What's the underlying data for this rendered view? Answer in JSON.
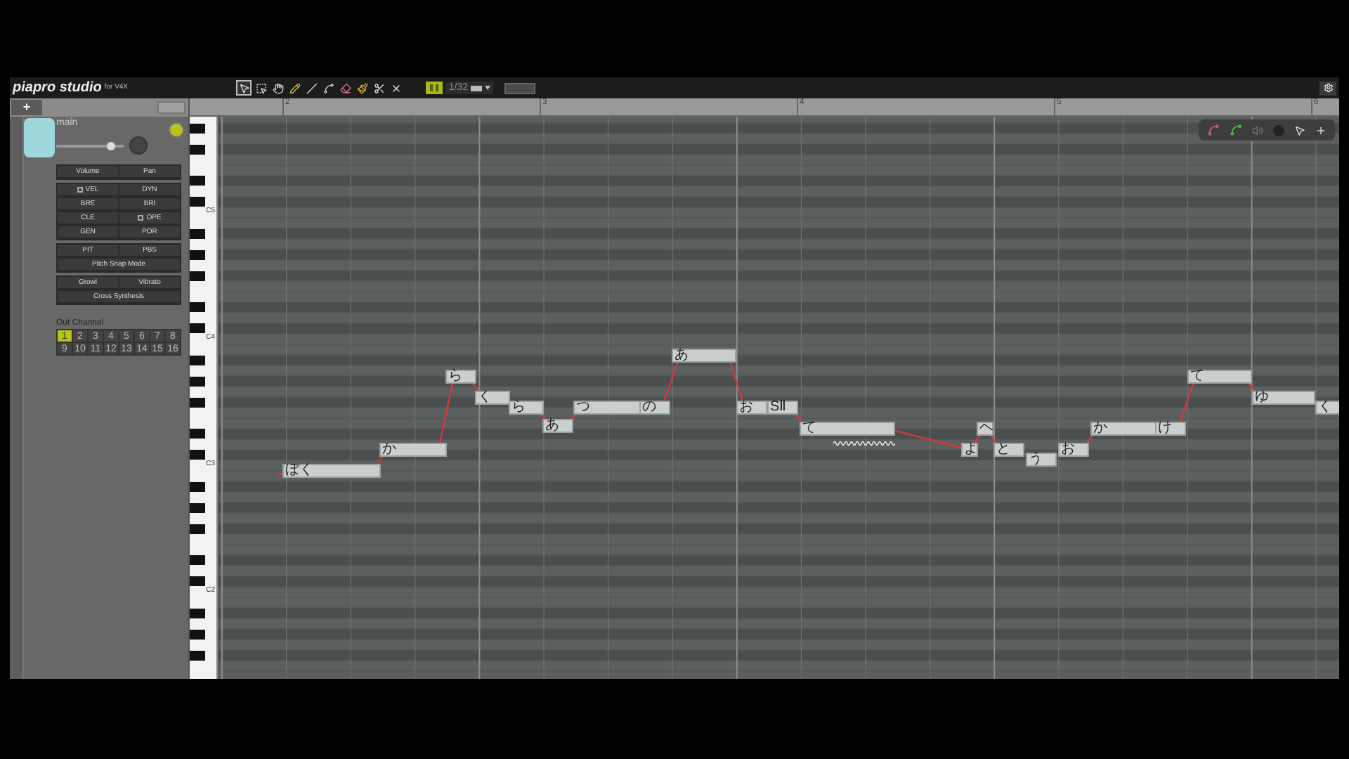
{
  "toolbar": {
    "logo": "piapro studio",
    "logo_sub": "for V4X",
    "tools": [
      {
        "kind": "pointer",
        "selected": true
      },
      {
        "kind": "select",
        "selected": false
      },
      {
        "kind": "hand",
        "selected": false
      },
      {
        "kind": "pencil",
        "selected": false
      },
      {
        "kind": "line",
        "selected": false
      },
      {
        "kind": "curve",
        "selected": false
      },
      {
        "kind": "eraser",
        "selected": false
      },
      {
        "kind": "brush",
        "selected": false
      },
      {
        "kind": "cut",
        "selected": false
      },
      {
        "kind": "close",
        "selected": false
      }
    ],
    "snap_on": true,
    "quantize": "1/32"
  },
  "add_track_button": "+",
  "track": {
    "name": "main",
    "level": 0.82
  },
  "param_groups": [
    [
      {
        "label": "Volume",
        "checkable": false
      },
      {
        "label": "Pan",
        "checkable": false
      }
    ],
    [
      {
        "label": "VEL",
        "checkable": true
      },
      {
        "label": "DYN",
        "checkable": false
      },
      {
        "label": "BRE",
        "checkable": false
      },
      {
        "label": "BRI",
        "checkable": false
      },
      {
        "label": "CLE",
        "checkable": false
      },
      {
        "label": "OPE",
        "checkable": true
      },
      {
        "label": "GEN",
        "checkable": false
      },
      {
        "label": "POR",
        "checkable": false
      }
    ],
    [
      {
        "label": "PIT",
        "checkable": false
      },
      {
        "label": "PBS",
        "checkable": false
      },
      {
        "label": "Pitch Snap Mode",
        "checkable": false,
        "wide": true
      }
    ],
    [
      {
        "label": "Growl",
        "checkable": false
      },
      {
        "label": "Vibrato",
        "checkable": false
      },
      {
        "label": "Cross Synthesis",
        "checkable": false,
        "wide": true
      }
    ]
  ],
  "out_channel": {
    "label": "Out Channel",
    "channels": [
      {
        "label": "1",
        "selected": true
      },
      {
        "label": "2",
        "selected": false
      },
      {
        "label": "3",
        "selected": false
      },
      {
        "label": "4",
        "selected": false
      },
      {
        "label": "5",
        "selected": false
      },
      {
        "label": "6",
        "selected": false
      },
      {
        "label": "7",
        "selected": false
      },
      {
        "label": "8",
        "selected": false
      },
      {
        "label": "9",
        "selected": false
      },
      {
        "label": "10",
        "selected": false
      },
      {
        "label": "11",
        "selected": false
      },
      {
        "label": "12",
        "selected": false
      },
      {
        "label": "13",
        "selected": false
      },
      {
        "label": "14",
        "selected": false
      },
      {
        "label": "15",
        "selected": false
      },
      {
        "label": "16",
        "selected": false
      }
    ]
  },
  "ruler": {
    "bars": [
      "2",
      "3",
      "4",
      "5",
      "6"
    ]
  },
  "piano": {
    "octave_labels": [
      "C5",
      "C4",
      "C3",
      "C2"
    ]
  },
  "notes": [
    {
      "lyric": "ぼく",
      "vibrato": false
    },
    {
      "lyric": "か",
      "vibrato": false
    },
    {
      "lyric": "ら",
      "vibrato": false
    },
    {
      "lyric": "く",
      "vibrato": false
    },
    {
      "lyric": "ら",
      "vibrato": false
    },
    {
      "lyric": "あ",
      "vibrato": false
    },
    {
      "lyric": "つ",
      "vibrato": false
    },
    {
      "lyric": "の",
      "vibrato": false
    },
    {
      "lyric": "あ",
      "vibrato": false
    },
    {
      "lyric": "お",
      "vibrato": false
    },
    {
      "lyric": "SⅡ",
      "vibrato": false
    },
    {
      "lyric": "て",
      "vibrato": true
    },
    {
      "lyric": "よ",
      "vibrato": false
    },
    {
      "lyric": "ヘ",
      "vibrato": false
    },
    {
      "lyric": "と",
      "vibrato": false
    },
    {
      "lyric": "う",
      "vibrato": false
    },
    {
      "lyric": "お",
      "vibrato": false
    },
    {
      "lyric": "か",
      "vibrato": false
    },
    {
      "lyric": "け",
      "vibrato": false
    },
    {
      "lyric": "て",
      "vibrato": false
    },
    {
      "lyric": "ゆ",
      "vibrato": false
    },
    {
      "lyric": "く",
      "vibrato": false
    }
  ]
}
